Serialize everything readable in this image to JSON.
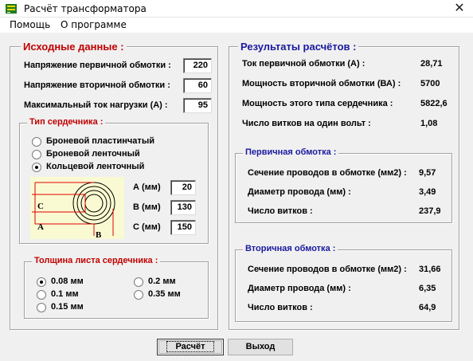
{
  "window": {
    "title": "Расчёт трансформатора"
  },
  "menu": {
    "help": "Помощь",
    "about": "О программе"
  },
  "input": {
    "legend": "Исходные данные :",
    "rows": [
      {
        "label": "Напряжение первичной обмотки :",
        "value": "220"
      },
      {
        "label": "Напряжение вторичной обмотки :",
        "value": "60"
      },
      {
        "label": "Максимальный ток нагрузки  (А) :",
        "value": "95"
      }
    ],
    "core_type": {
      "legend": "Тип сердечника :",
      "options": [
        "Броневой пластинчатый",
        "Броневой ленточный",
        "Кольцевой ленточный"
      ],
      "selected": 2,
      "diagram_labels": {
        "c": "C",
        "a": "A",
        "b": "B"
      },
      "dims": [
        {
          "label": "А (мм)",
          "value": "20"
        },
        {
          "label": "В (мм)",
          "value": "130"
        },
        {
          "label": "С (мм)",
          "value": "150"
        }
      ]
    },
    "thickness": {
      "legend": "Толщина листа сердечника :",
      "options": [
        "0.08 мм",
        "0.1 мм",
        "0.15 мм",
        "0.2 мм",
        "0.35 мм"
      ],
      "selected": 0
    }
  },
  "results": {
    "legend": "Результаты расчётов :",
    "rows": [
      {
        "label": "Ток первичной обмотки (А) :",
        "value": "28,71"
      },
      {
        "label": "Мощность вторичной обмотки (ВА) :",
        "value": "5700"
      },
      {
        "label": "Мощность  этого типа сердечника :",
        "value": "5822,6"
      },
      {
        "label": "Число витков на один вольт :",
        "value": "1,08"
      }
    ],
    "primary": {
      "legend": "Первичная обмотка :",
      "rows": [
        {
          "label": "Сечение проводов в обмотке (мм2) :",
          "value": "9,57"
        },
        {
          "label": "Диаметр провода (мм) :",
          "value": "3,49"
        },
        {
          "label": "Число витков :",
          "value": "237,9"
        }
      ]
    },
    "secondary": {
      "legend": "Вторичная обмотка :",
      "rows": [
        {
          "label": "Сечение проводов в обмотке (мм2) :",
          "value": "31,66"
        },
        {
          "label": "Диаметр провода (мм) :",
          "value": "6,35"
        },
        {
          "label": "Число витков :",
          "value": "64,9"
        }
      ]
    }
  },
  "buttons": {
    "calculate": "Расчёт",
    "exit": "Выход"
  },
  "colors": {
    "legend_red": "#c00000",
    "legend_blue": "#1a1aa0",
    "diagram_bg": "#fafad2",
    "diagram_red": "#e00000"
  }
}
